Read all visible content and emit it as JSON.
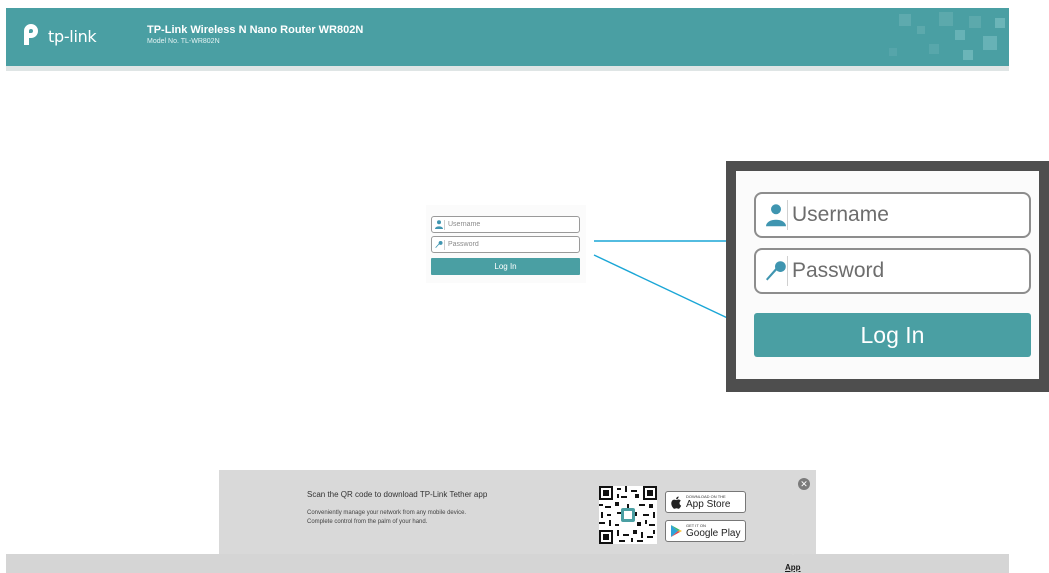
{
  "header": {
    "logo_text": "tp-link",
    "product_name": "TP-Link Wireless N Nano Router WR802N",
    "model_no": "Model No. TL-WR802N"
  },
  "login": {
    "username_placeholder": "Username",
    "password_placeholder": "Password",
    "login_label": "Log In"
  },
  "zoom": {
    "username_placeholder": "Username",
    "password_placeholder": "Password",
    "login_label": "Log In"
  },
  "banner": {
    "heading": "Scan the QR code to download TP-Link Tether app",
    "line1": "Conveniently manage your network from any mobile device.",
    "line2": "Complete control from the palm of your hand.",
    "app_store_small": "DOWNLOAD ON THE",
    "app_store_big": "App Store",
    "google_play_small": "GET IT ON",
    "google_play_big": "Google Play",
    "close_icon": "close-icon"
  },
  "footer": {
    "app_link": "App"
  },
  "colors": {
    "brand": "#4a9fa3",
    "callout_frame": "#4e4e4e",
    "connector": "#1aa6d6"
  }
}
